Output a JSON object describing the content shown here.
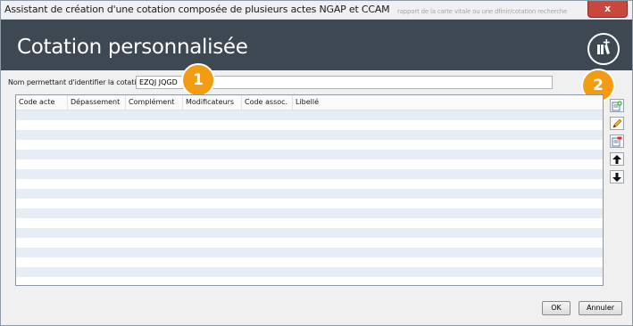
{
  "window": {
    "title": "Assistant de création d'une cotation composée de plusieurs actes NGAP et CCAM",
    "close_label": "x",
    "background_text": "rapport de la carte vitale ou une dfinir/cotation recherche"
  },
  "banner": {
    "heading": "Cotation personnalisée",
    "icon": "add-document-icon"
  },
  "name_field": {
    "label": "Nom permettant d'identifier la cotation :",
    "value": "EZQJ JQGD"
  },
  "callouts": [
    "1",
    "2"
  ],
  "table": {
    "columns": [
      "Code acte",
      "Dépassement",
      "Complément",
      "Modificateurs",
      "Code assoc.",
      "Libellé"
    ],
    "rows": []
  },
  "toolbar": {
    "icons": [
      "add-row-icon",
      "edit-icon",
      "delete-row-icon",
      "arrow-up-icon",
      "arrow-down-icon"
    ]
  },
  "buttons": {
    "ok": "OK",
    "cancel": "Annuler"
  },
  "colors": {
    "banner": "#3d4852",
    "callout": "#f39c12",
    "row_alt": "#e6edf5",
    "close": "#c9483d"
  }
}
